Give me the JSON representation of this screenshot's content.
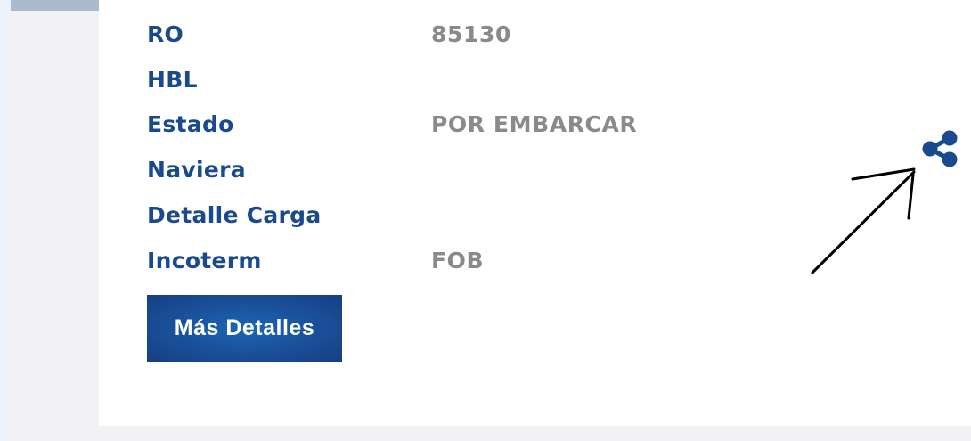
{
  "details": {
    "rows": [
      {
        "label": "RO",
        "value": "85130"
      },
      {
        "label": "HBL",
        "value": ""
      },
      {
        "label": "Estado",
        "value": "POR EMBARCAR"
      },
      {
        "label": "Naviera",
        "value": ""
      },
      {
        "label": "Detalle Carga",
        "value": ""
      },
      {
        "label": "Incoterm",
        "value": "FOB"
      }
    ],
    "more_button_label": "Más Detalles"
  },
  "icons": {
    "share": "share-icon",
    "annotation": "hand-drawn-arrow"
  },
  "colors": {
    "label": "#1a4a8e",
    "value": "#8a8a8a",
    "button": "#1a4f98",
    "icon": "#1a4a8e"
  }
}
